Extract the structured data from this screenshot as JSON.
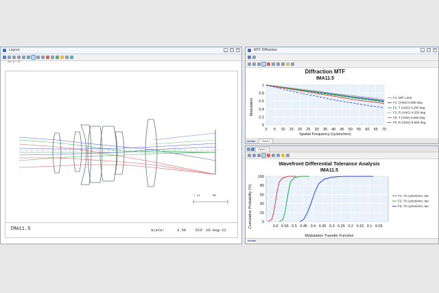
{
  "layout_window": {
    "title": "Layout",
    "stamp": "19:07:37",
    "lens_name": "IMA11.5",
    "scale_label": "Scale:",
    "scale_value": "3.50",
    "units": "DIO",
    "date": "26-Aug-22",
    "scalebar_value": "7.14",
    "scalebar_unit": "MM"
  },
  "mtf_window": {
    "title": "MTF Diffraction",
    "tab_label": "Chart 1",
    "logo": "zemax"
  },
  "tol_window": {
    "tab_label": "Chart 1",
    "logo": "zemax"
  },
  "colors": {
    "blue": "#2f3fd6",
    "green": "#1aa83a",
    "red": "#d63a3a",
    "gray": "#9a9a9a",
    "lens": "#6a7080",
    "plot_bg": "#e9f1fb",
    "grid": "#ffffff"
  },
  "chart_data": [
    {
      "type": "line",
      "title": "Diffraction MTF",
      "subtitle": "IMA11.5",
      "xlabel": "Spatial Frequency (cycles/mm)",
      "ylabel": "Modulation",
      "xlim": [
        0,
        70
      ],
      "ylim": [
        0,
        1
      ],
      "xticks": [
        0,
        5,
        10,
        15,
        20,
        25,
        30,
        35,
        40,
        45,
        50,
        55,
        60,
        65,
        70
      ],
      "yticks": [
        0,
        0.2,
        0.4,
        0.6,
        0.8,
        1
      ],
      "grid": true,
      "legend_position": "right",
      "x": [
        0,
        10,
        20,
        30,
        40,
        50,
        60,
        70
      ],
      "series": [
        {
          "name": "F1: Diff. Limit",
          "color": "#9a9a9a",
          "dash": false,
          "values": [
            1,
            0.95,
            0.9,
            0.85,
            0.79,
            0.74,
            0.69,
            0.63
          ]
        },
        {
          "name": "F1: (ANG) 0.000 deg",
          "color": "#2f3fd6",
          "dash": false,
          "values": [
            1,
            0.94,
            0.88,
            0.83,
            0.77,
            0.71,
            0.66,
            0.6
          ]
        },
        {
          "name": "F2: T (ANG) 4.250 deg",
          "color": "#1aa83a",
          "dash": false,
          "values": [
            1,
            0.94,
            0.88,
            0.82,
            0.76,
            0.7,
            0.64,
            0.59
          ]
        },
        {
          "name": "F2: R (ANG) 4.250 deg",
          "color": "#1aa83a",
          "dash": true,
          "values": [
            1,
            0.93,
            0.87,
            0.81,
            0.75,
            0.69,
            0.63,
            0.57
          ]
        },
        {
          "name": "F3: T (ANG) 8.500 deg",
          "color": "#d63a3a",
          "dash": false,
          "values": [
            1,
            0.93,
            0.86,
            0.79,
            0.72,
            0.65,
            0.59,
            0.54
          ]
        },
        {
          "name": "F3: R (ANG) 8.500 deg",
          "color": "#2f3fd6",
          "dash": true,
          "values": [
            1,
            0.9,
            0.8,
            0.72,
            0.63,
            0.56,
            0.49,
            0.43
          ]
        }
      ]
    },
    {
      "type": "line",
      "title": "Wavefront Differential Tolerance Analysis",
      "subtitle": "IMA11.5",
      "xlabel": "Modulation Transfer Function",
      "ylabel": "Cumulative Probability (%)",
      "x_reversed": true,
      "xlim": [
        0.65,
        0
      ],
      "ylim": [
        0,
        100
      ],
      "xtick_labels": [
        "0.6",
        "0.55",
        "0.5",
        "0.45",
        "0.4",
        "0.35",
        "0.3",
        "0.25",
        "0.2",
        "0.15",
        "0.1",
        "0.05"
      ],
      "xticks": [
        0.6,
        0.55,
        0.5,
        0.45,
        0.4,
        0.35,
        0.3,
        0.25,
        0.2,
        0.15,
        0.1,
        0.05
      ],
      "yticks": [
        0,
        20,
        40,
        60,
        80,
        100
      ],
      "grid": true,
      "legend_position": "right",
      "series": [
        {
          "name": "F1, 70 cycles/mm, tan",
          "color": "#d63a3a",
          "x": [
            0.64,
            0.62,
            0.61,
            0.6,
            0.59,
            0.58,
            0.56,
            0.53,
            0.49
          ],
          "values": [
            0,
            5,
            20,
            45,
            70,
            88,
            97,
            100,
            100
          ]
        },
        {
          "name": "F2, 70 cycles/mm, tan",
          "color": "#1aa83a",
          "x": [
            0.58,
            0.56,
            0.55,
            0.54,
            0.53,
            0.52,
            0.5,
            0.47,
            0.42
          ],
          "values": [
            0,
            5,
            20,
            45,
            70,
            88,
            97,
            100,
            100
          ]
        },
        {
          "name": "F3, 70 cycles/mm, tan",
          "color": "#2f3fd6",
          "x": [
            0.47,
            0.45,
            0.43,
            0.41,
            0.39,
            0.37,
            0.34,
            0.3,
            0.24,
            0.08
          ],
          "values": [
            0,
            5,
            20,
            42,
            66,
            84,
            94,
            98,
            100,
            100
          ]
        }
      ]
    }
  ]
}
